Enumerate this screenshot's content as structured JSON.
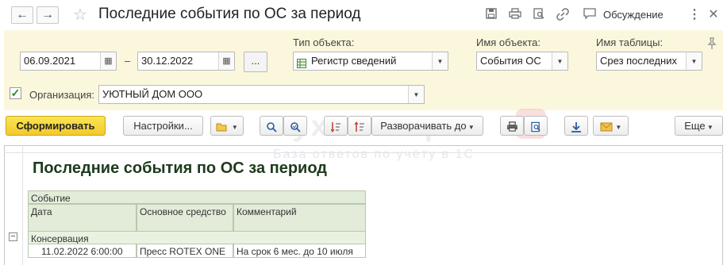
{
  "window": {
    "title": "Последние события по ОС за период",
    "discuss_label": "Обсуждение",
    "icons": [
      "arrow-left-icon",
      "arrow-right-icon",
      "star-icon",
      "save-icon",
      "print-icon",
      "preview-icon",
      "link-icon",
      "chat-icon",
      "more-vert-icon",
      "close-icon"
    ]
  },
  "filters": {
    "date_from": "06.09.2021",
    "dash": "–",
    "date_to": "30.12.2022",
    "dots_label": "...",
    "object_type_label": "Тип объекта:",
    "object_type_value": "Регистр сведений",
    "object_name_label": "Имя объекта:",
    "object_name_value": "События ОС",
    "table_name_label": "Имя таблицы:",
    "table_name_value": "Срез последних",
    "org_label": "Организация:",
    "org_value": "УЮТНЫЙ ДОМ ООО",
    "org_checked": true
  },
  "toolbar": {
    "generate": "Сформировать",
    "settings": "Настройки...",
    "expand": "Разворачивать до",
    "more": "Еще"
  },
  "watermark": {
    "line1": "БухЭксперт",
    "line2": "База ответов по учёту в 1С"
  },
  "report": {
    "title": "Последние события по ОС за период",
    "header_top": "Событие",
    "columns": [
      "Дата",
      "Основное средство",
      "Комментарий"
    ],
    "group_label": "Консервация",
    "rows": [
      {
        "date": "11.02.2022 6:00:00",
        "asset": "Пресс ROTEX ONE",
        "comment": "На срок 6 мес. до 10 июля"
      }
    ]
  },
  "colors": {
    "panel_bg": "#fbf7dc",
    "primary_button": "#f1c92c",
    "table_header": "#e2ecd8",
    "report_title": "#1d3a1d"
  }
}
